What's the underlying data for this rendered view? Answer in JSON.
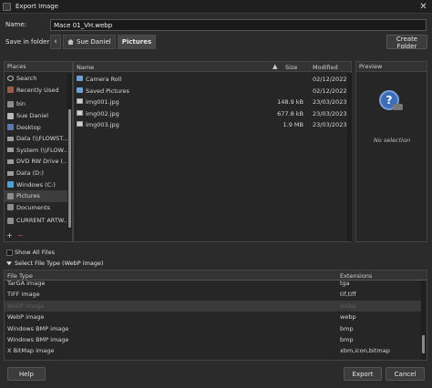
{
  "window": {
    "title": "Export Image",
    "close_glyph": "✕",
    "app_icon": "gimp-icon"
  },
  "name_row": {
    "label": "Name:",
    "value": "Mace 01_VH.webp"
  },
  "folder_row": {
    "label": "Save in folder:",
    "back_glyph": "‹",
    "crumbs": [
      "Sue Daniel",
      "Pictures"
    ],
    "create_folder_label": "Create Folder"
  },
  "places": {
    "header": "Places",
    "items": [
      {
        "label": "Search",
        "icon": "search-icon"
      },
      {
        "label": "Recently Used",
        "icon": "recent-icon"
      },
      {
        "label": "bin",
        "icon": "folder-icon"
      },
      {
        "label": "Sue Daniel",
        "icon": "home-icon"
      },
      {
        "label": "Desktop",
        "icon": "desktop-icon"
      },
      {
        "label": "Data (\\\\FLOWST...",
        "icon": "drive-icon"
      },
      {
        "label": "System (\\\\FLOW...",
        "icon": "drive-icon"
      },
      {
        "label": "DVD RW Drive (...",
        "icon": "drive-icon"
      },
      {
        "label": "Data (D:)",
        "icon": "drive-icon"
      },
      {
        "label": "Windows (C:)",
        "icon": "windows-icon"
      },
      {
        "label": "Pictures",
        "icon": "folder-icon",
        "selected": true
      },
      {
        "label": "Documents",
        "icon": "folder-icon"
      },
      {
        "label": "CURRENT ARTW...",
        "icon": "folder-icon"
      }
    ],
    "add_glyph": "+",
    "remove_glyph": "−"
  },
  "files": {
    "columns": {
      "name": "Name",
      "size": "Size",
      "modified": "Modified",
      "sort_glyph": "▲"
    },
    "rows": [
      {
        "name": "Camera Roll",
        "size": "",
        "modified": "02/12/2022",
        "type": "folder"
      },
      {
        "name": "Saved Pictures",
        "size": "",
        "modified": "02/12/2022",
        "type": "folder"
      },
      {
        "name": "img001.jpg",
        "size": "148.9 kB",
        "modified": "23/03/2023",
        "type": "image"
      },
      {
        "name": "img002.jpg",
        "size": "677.8 kB",
        "modified": "23/03/2023",
        "type": "image"
      },
      {
        "name": "img003.jpg",
        "size": "1.9 MB",
        "modified": "23/03/2023",
        "type": "image"
      }
    ]
  },
  "preview": {
    "header": "Preview",
    "empty_text": "No selection",
    "icon_glyph": "?"
  },
  "show_all_files": {
    "label": "Show All Files",
    "checked": false
  },
  "file_type": {
    "expander_label": "Select File Type (WebP image)",
    "columns": {
      "type": "File Type",
      "ext": "Extensions"
    },
    "rows": [
      {
        "type": "TarGA image",
        "ext": "tga"
      },
      {
        "type": "TIFF image",
        "ext": "tif,tiff"
      },
      {
        "type": "WebP image",
        "ext": "webp",
        "selected": true
      },
      {
        "type": "WebP image",
        "ext": "webp"
      },
      {
        "type": "Windows BMP image",
        "ext": "bmp"
      },
      {
        "type": "Windows BMP image",
        "ext": "bmp"
      },
      {
        "type": "X BitMap image",
        "ext": "xbm,icon,bitmap"
      }
    ]
  },
  "buttons": {
    "help": "Help",
    "export": "Export",
    "cancel": "Cancel"
  }
}
